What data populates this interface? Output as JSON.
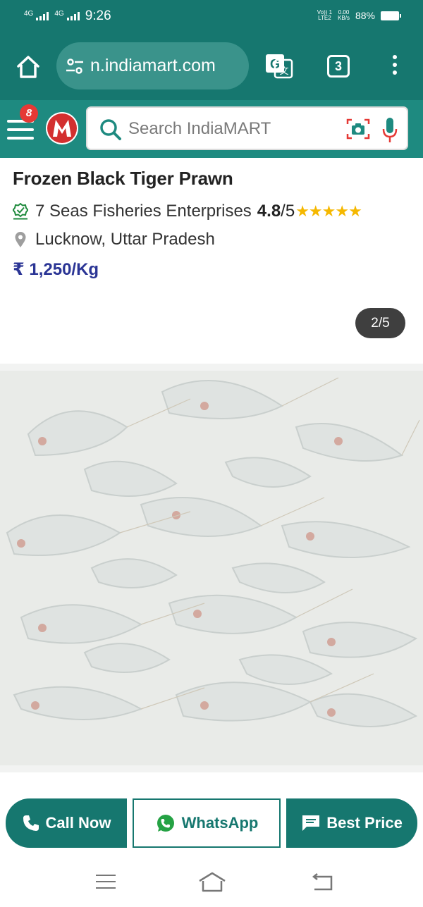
{
  "status_bar": {
    "network_1": "4G",
    "network_2": "4G",
    "time": "9:26",
    "volte_top": "Vo)) 1",
    "volte_bottom": "LTE2",
    "speed_value": "0.00",
    "speed_unit": "KB/s",
    "battery": "88%"
  },
  "browser": {
    "url": "n.indiamart.com",
    "tab_count": "3",
    "icons": [
      "home-icon",
      "site-settings-icon",
      "translate-icon",
      "more-vert-icon"
    ]
  },
  "header": {
    "notification_count": "8",
    "logo_letter": "M",
    "search_placeholder": "Search IndiaMART",
    "colors": {
      "primary": "#16776f",
      "header": "#1e8a80",
      "price": "#2b3595",
      "star": "#f5b800",
      "logo_red": "#e53935"
    }
  },
  "product": {
    "title": "Frozen Black Tiger Prawn",
    "seller": "7 Seas Fisheries Enterprises",
    "rating": "4.8",
    "rating_max": "/5",
    "stars": "★★★★★",
    "location": "Lucknow, Uttar Pradesh",
    "price": "₹ 1,250/Kg",
    "image_counter": "2/5"
  },
  "actions": {
    "call": "Call Now",
    "whatsapp": "WhatsApp",
    "best_price": "Best Price"
  }
}
